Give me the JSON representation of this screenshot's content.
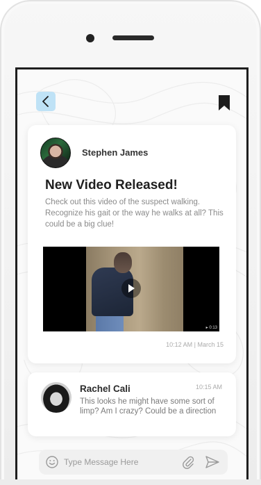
{
  "header": {
    "back_icon": "chevron-left-icon",
    "bookmark_icon": "bookmark-icon",
    "accent_color": "#bfe2f6"
  },
  "post": {
    "author": "Stephen James",
    "title": "New Video Released!",
    "body": "Check out this video of the suspect walking. Recognize his gait or the way he walks at all? This could be a big clue!",
    "video_duration": "▸ 0:13",
    "timestamp": "10:12 AM | March 15"
  },
  "comment": {
    "author": "Rachel Cali",
    "time": "10:15 AM",
    "text": "This looks he might have some sort of limp? Am I crazy? Could be a direction"
  },
  "composer": {
    "placeholder": "Type Message Here",
    "emoji_icon": "smiley-icon",
    "attach_icon": "paperclip-icon",
    "send_icon": "send-icon"
  }
}
